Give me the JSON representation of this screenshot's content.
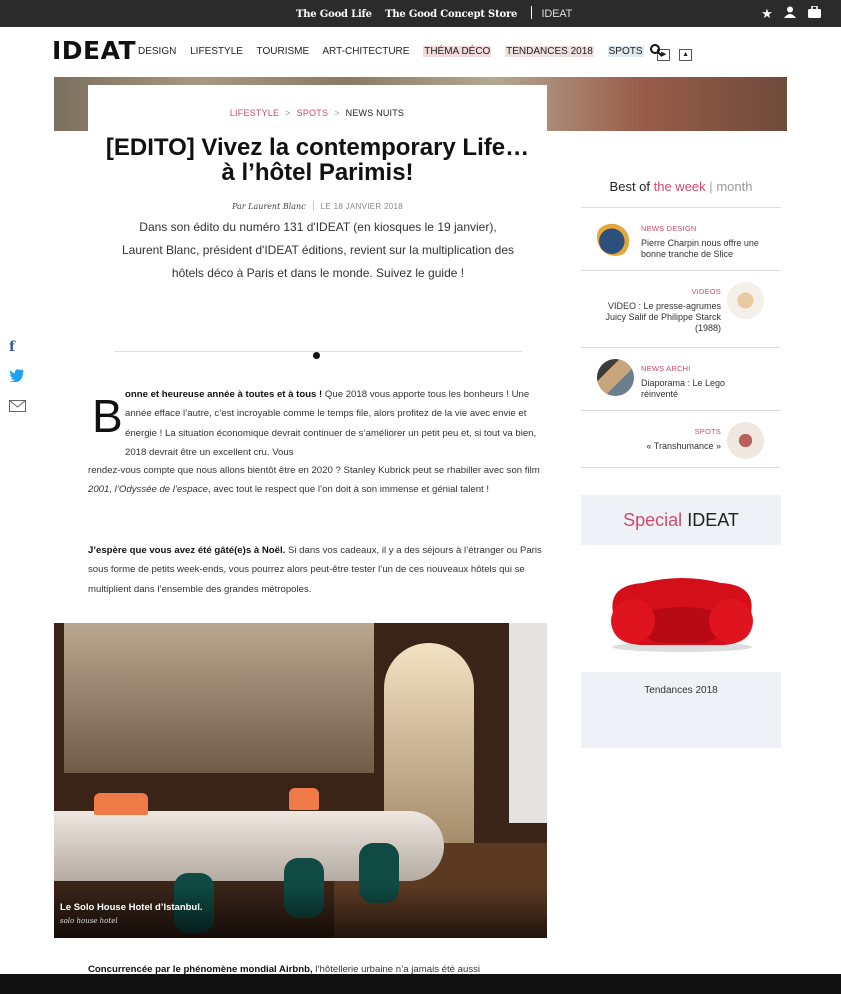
{
  "topbar": {
    "link1": "The Good Life",
    "link2": "The Good Concept Store",
    "link3": "IDEAT",
    "icons": [
      "star-icon",
      "user-icon",
      "bag-icon"
    ]
  },
  "nav": {
    "logo": "IDEAT",
    "items": [
      "DESIGN",
      "LIFESTYLE",
      "TOURISME",
      "ART-CHITECTURE",
      "THÉMA DÉCO",
      "TENDANCES 2018",
      "SPOTS"
    ]
  },
  "breadcrumb": [
    "LIFESTYLE",
    "SPOTS",
    "NEWS NUITS"
  ],
  "article": {
    "title_line1": "[EDITO] Vivez la contemporary Life…",
    "title_line2": "à l’hôtel Parimis!",
    "author": "Par Laurent Blanc",
    "date": "LE 18 JANVIER 2018",
    "intro": "Dans son édito du numéro 131 d'IDEAT (en kiosques le 19 janvier), Laurent Blanc, président d'IDEAT éditions, revient sur la multiplication des hôtels déco à Paris et dans le monde. Suivez le guide !",
    "dropcap": "B",
    "p1_bold": "onne et heureuse année à toutes et à tous !",
    "p1_rest": " Que 2018 vous apporte tous les bonheurs ! Une année efface l’autre, c’est incroyable comme le temps file, alors profitez de la vie avec envie et énergie ! La situation économique devrait continuer de s’améliorer un petit peu et, si tout va bien, 2018 devrait être un excellent cru. Vous",
    "p1_cont": "rendez-vous compte que nous allons bientôt être en 2020 ? Stanley Kubrick peut se rhabiller avec son film ",
    "p1_italic": "2001, l’Odyssée de l’espace",
    "p1_end": ", avec tout le respect que l’on doit à son immense et génial talent !",
    "p2_bold": "J’espère que vous avez été gâté(e)s à Noël.",
    "p2_rest": " Si dans vos cadeaux, il y a des séjours à l’étranger ou Paris sous forme de petits week-ends, vous pourrez alors peut-être tester l’un de ces nouveaux hôtels qui se multiplient dans l’ensemble des grandes métropoles.",
    "photo_caption": "Le Solo House Hotel d’Istanbul.",
    "photo_credit": "solo house hotel",
    "p3_bold": "Concurrencée par le phénomène mondial Airbnb,",
    "p3_rest": " l’hôtellerie urbaine n’a jamais été aussi"
  },
  "sidebar": {
    "best_prefix": "Best of ",
    "best_week": "the week",
    "best_sep": "|",
    "best_month": "month",
    "items": [
      {
        "category": "NEWS DESIGN",
        "text": "Pierre Charpin nous offre une bonne tranche de Slice"
      },
      {
        "category": "VIDEOS",
        "text": "VIDEO : Le presse-agrumes Juicy Salif de Philippe Starck (1988)"
      },
      {
        "category": "NEWS ARCHI",
        "text": "Diaporama : Le Lego réinventé"
      },
      {
        "category": "SPOTS",
        "text": "« Transhumance »"
      }
    ],
    "special_prefix": "Special ",
    "special_brand": "IDEAT",
    "tendances": "Tendances 2018"
  },
  "colors": {
    "accent": "#d14a6d",
    "topbar": "#2b2b2b",
    "panel": "#eef2f6"
  }
}
